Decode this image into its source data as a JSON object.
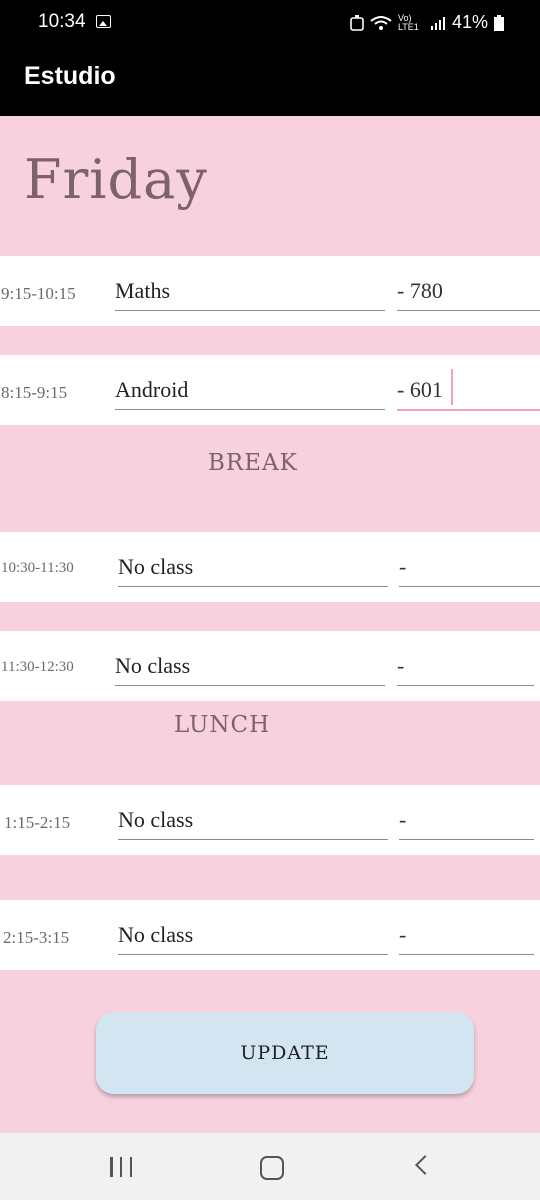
{
  "status": {
    "time": "10:34",
    "network": "Vo) LTE1",
    "battery": "41%"
  },
  "app": {
    "title": "Estudio"
  },
  "day": "Friday",
  "slots": [
    {
      "time": "9:15-10:15",
      "subject": "Maths",
      "room": "- 780"
    },
    {
      "time": "8:15-9:15",
      "subject": "Android",
      "room": "- 601"
    },
    {
      "time": "10:30-11:30",
      "subject": "No class",
      "room": "-"
    },
    {
      "time": "11:30-12:30",
      "subject": "No class",
      "room": "-"
    },
    {
      "time": "1:15-2:15",
      "subject": "No class",
      "room": "-"
    },
    {
      "time": "2:15-3:15",
      "subject": "No class",
      "room": "-"
    }
  ],
  "labels": {
    "break": "BREAK",
    "lunch": "LUNCH"
  },
  "update_label": "UPDATE"
}
